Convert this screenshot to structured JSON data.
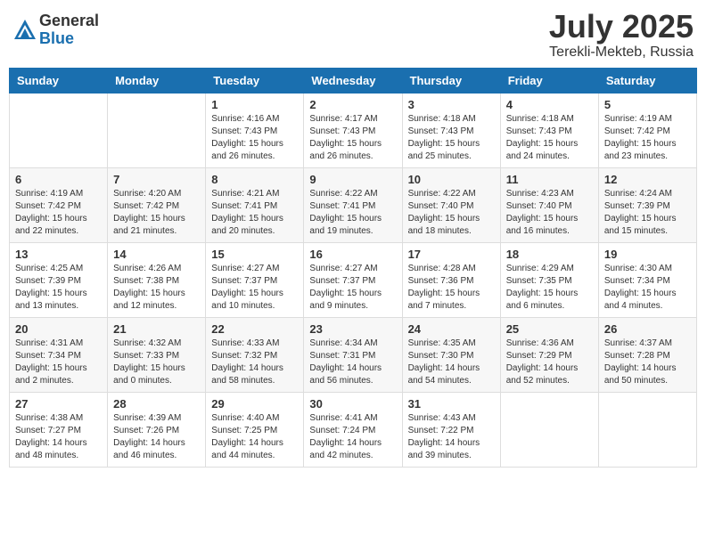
{
  "header": {
    "logo_general": "General",
    "logo_blue": "Blue",
    "month_title": "July 2025",
    "location": "Terekli-Mekteb, Russia"
  },
  "weekdays": [
    "Sunday",
    "Monday",
    "Tuesday",
    "Wednesday",
    "Thursday",
    "Friday",
    "Saturday"
  ],
  "weeks": [
    [
      {
        "day": "",
        "info": ""
      },
      {
        "day": "",
        "info": ""
      },
      {
        "day": "1",
        "info": "Sunrise: 4:16 AM\nSunset: 7:43 PM\nDaylight: 15 hours\nand 26 minutes."
      },
      {
        "day": "2",
        "info": "Sunrise: 4:17 AM\nSunset: 7:43 PM\nDaylight: 15 hours\nand 26 minutes."
      },
      {
        "day": "3",
        "info": "Sunrise: 4:18 AM\nSunset: 7:43 PM\nDaylight: 15 hours\nand 25 minutes."
      },
      {
        "day": "4",
        "info": "Sunrise: 4:18 AM\nSunset: 7:43 PM\nDaylight: 15 hours\nand 24 minutes."
      },
      {
        "day": "5",
        "info": "Sunrise: 4:19 AM\nSunset: 7:42 PM\nDaylight: 15 hours\nand 23 minutes."
      }
    ],
    [
      {
        "day": "6",
        "info": "Sunrise: 4:19 AM\nSunset: 7:42 PM\nDaylight: 15 hours\nand 22 minutes."
      },
      {
        "day": "7",
        "info": "Sunrise: 4:20 AM\nSunset: 7:42 PM\nDaylight: 15 hours\nand 21 minutes."
      },
      {
        "day": "8",
        "info": "Sunrise: 4:21 AM\nSunset: 7:41 PM\nDaylight: 15 hours\nand 20 minutes."
      },
      {
        "day": "9",
        "info": "Sunrise: 4:22 AM\nSunset: 7:41 PM\nDaylight: 15 hours\nand 19 minutes."
      },
      {
        "day": "10",
        "info": "Sunrise: 4:22 AM\nSunset: 7:40 PM\nDaylight: 15 hours\nand 18 minutes."
      },
      {
        "day": "11",
        "info": "Sunrise: 4:23 AM\nSunset: 7:40 PM\nDaylight: 15 hours\nand 16 minutes."
      },
      {
        "day": "12",
        "info": "Sunrise: 4:24 AM\nSunset: 7:39 PM\nDaylight: 15 hours\nand 15 minutes."
      }
    ],
    [
      {
        "day": "13",
        "info": "Sunrise: 4:25 AM\nSunset: 7:39 PM\nDaylight: 15 hours\nand 13 minutes."
      },
      {
        "day": "14",
        "info": "Sunrise: 4:26 AM\nSunset: 7:38 PM\nDaylight: 15 hours\nand 12 minutes."
      },
      {
        "day": "15",
        "info": "Sunrise: 4:27 AM\nSunset: 7:37 PM\nDaylight: 15 hours\nand 10 minutes."
      },
      {
        "day": "16",
        "info": "Sunrise: 4:27 AM\nSunset: 7:37 PM\nDaylight: 15 hours\nand 9 minutes."
      },
      {
        "day": "17",
        "info": "Sunrise: 4:28 AM\nSunset: 7:36 PM\nDaylight: 15 hours\nand 7 minutes."
      },
      {
        "day": "18",
        "info": "Sunrise: 4:29 AM\nSunset: 7:35 PM\nDaylight: 15 hours\nand 6 minutes."
      },
      {
        "day": "19",
        "info": "Sunrise: 4:30 AM\nSunset: 7:34 PM\nDaylight: 15 hours\nand 4 minutes."
      }
    ],
    [
      {
        "day": "20",
        "info": "Sunrise: 4:31 AM\nSunset: 7:34 PM\nDaylight: 15 hours\nand 2 minutes."
      },
      {
        "day": "21",
        "info": "Sunrise: 4:32 AM\nSunset: 7:33 PM\nDaylight: 15 hours\nand 0 minutes."
      },
      {
        "day": "22",
        "info": "Sunrise: 4:33 AM\nSunset: 7:32 PM\nDaylight: 14 hours\nand 58 minutes."
      },
      {
        "day": "23",
        "info": "Sunrise: 4:34 AM\nSunset: 7:31 PM\nDaylight: 14 hours\nand 56 minutes."
      },
      {
        "day": "24",
        "info": "Sunrise: 4:35 AM\nSunset: 7:30 PM\nDaylight: 14 hours\nand 54 minutes."
      },
      {
        "day": "25",
        "info": "Sunrise: 4:36 AM\nSunset: 7:29 PM\nDaylight: 14 hours\nand 52 minutes."
      },
      {
        "day": "26",
        "info": "Sunrise: 4:37 AM\nSunset: 7:28 PM\nDaylight: 14 hours\nand 50 minutes."
      }
    ],
    [
      {
        "day": "27",
        "info": "Sunrise: 4:38 AM\nSunset: 7:27 PM\nDaylight: 14 hours\nand 48 minutes."
      },
      {
        "day": "28",
        "info": "Sunrise: 4:39 AM\nSunset: 7:26 PM\nDaylight: 14 hours\nand 46 minutes."
      },
      {
        "day": "29",
        "info": "Sunrise: 4:40 AM\nSunset: 7:25 PM\nDaylight: 14 hours\nand 44 minutes."
      },
      {
        "day": "30",
        "info": "Sunrise: 4:41 AM\nSunset: 7:24 PM\nDaylight: 14 hours\nand 42 minutes."
      },
      {
        "day": "31",
        "info": "Sunrise: 4:43 AM\nSunset: 7:22 PM\nDaylight: 14 hours\nand 39 minutes."
      },
      {
        "day": "",
        "info": ""
      },
      {
        "day": "",
        "info": ""
      }
    ]
  ]
}
